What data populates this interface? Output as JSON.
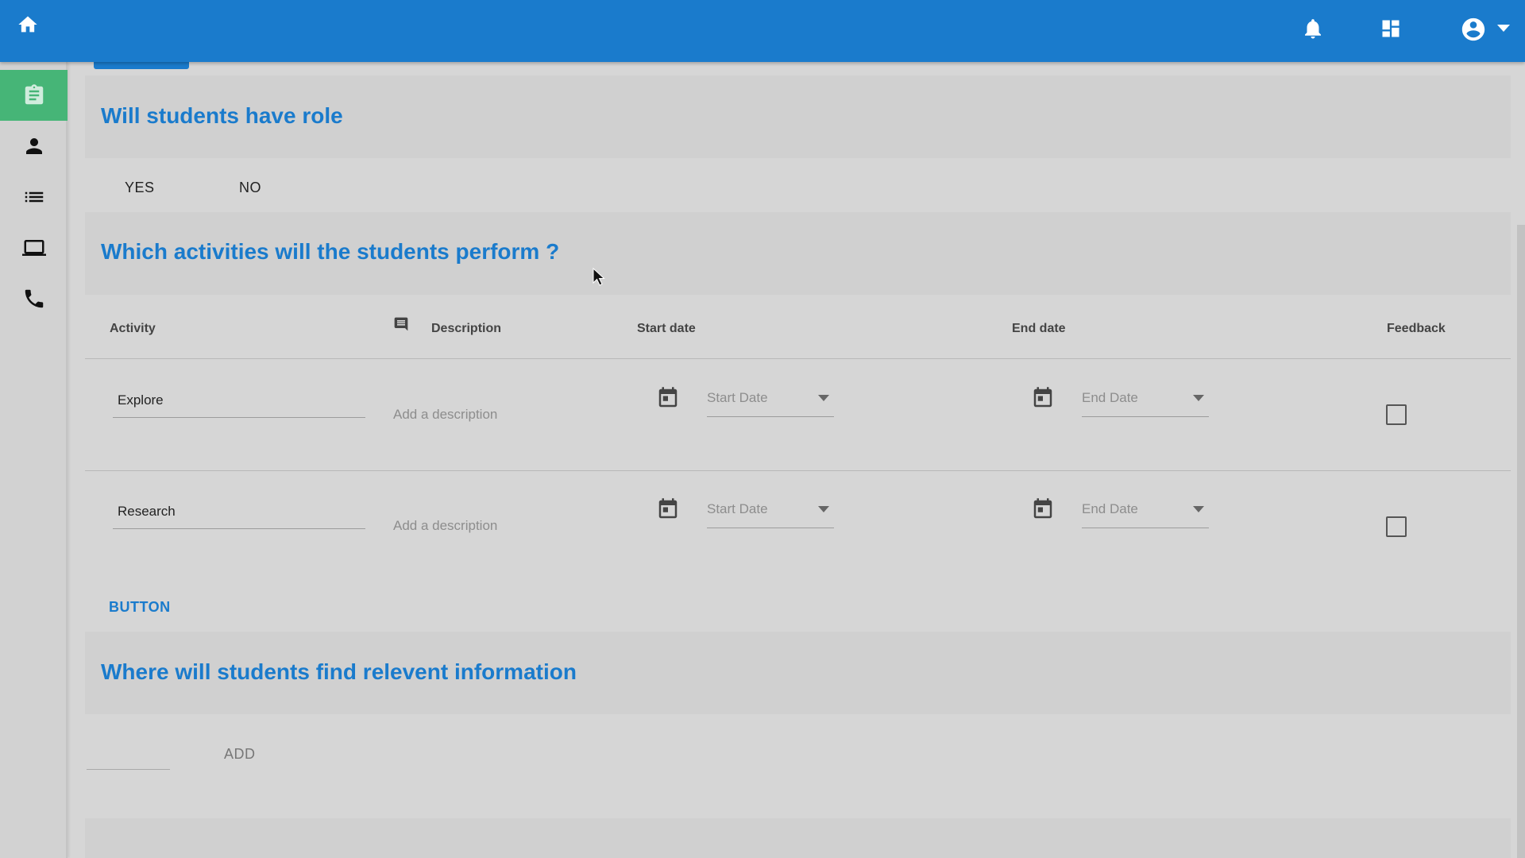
{
  "topbar": {
    "home_icon": "home-icon",
    "notifications_icon": "bell-icon",
    "dashboard_icon": "dashboard-icon",
    "account_icon": "account-circle-icon",
    "color": "#1a7bcc"
  },
  "sidebar": {
    "items": [
      {
        "name": "clipboard-icon",
        "active": true
      },
      {
        "name": "person-icon",
        "active": false
      },
      {
        "name": "list-icon",
        "active": false
      },
      {
        "name": "laptop-icon",
        "active": false
      },
      {
        "name": "phone-icon",
        "active": false
      }
    ],
    "active_color": "#46b577"
  },
  "role_section": {
    "title": "Will students have role",
    "options": [
      "YES",
      "NO"
    ]
  },
  "activities_section": {
    "title": "Which activities will the students perform ?",
    "columns": {
      "activity": "Activity",
      "description": "Description",
      "start_date": "Start date",
      "end_date": "End date",
      "feedback": "Feedback"
    },
    "rows": [
      {
        "activity": "Explore",
        "description_placeholder": "Add a description",
        "start_placeholder": "Start Date",
        "end_placeholder": "End Date",
        "feedback": false
      },
      {
        "activity": "Research",
        "description_placeholder": "Add a description",
        "start_placeholder": "Start Date",
        "end_placeholder": "End Date",
        "feedback": false
      }
    ],
    "button_label": "BUTTON"
  },
  "info_section": {
    "title": "Where will students find relevent information",
    "add_label": "ADD"
  }
}
